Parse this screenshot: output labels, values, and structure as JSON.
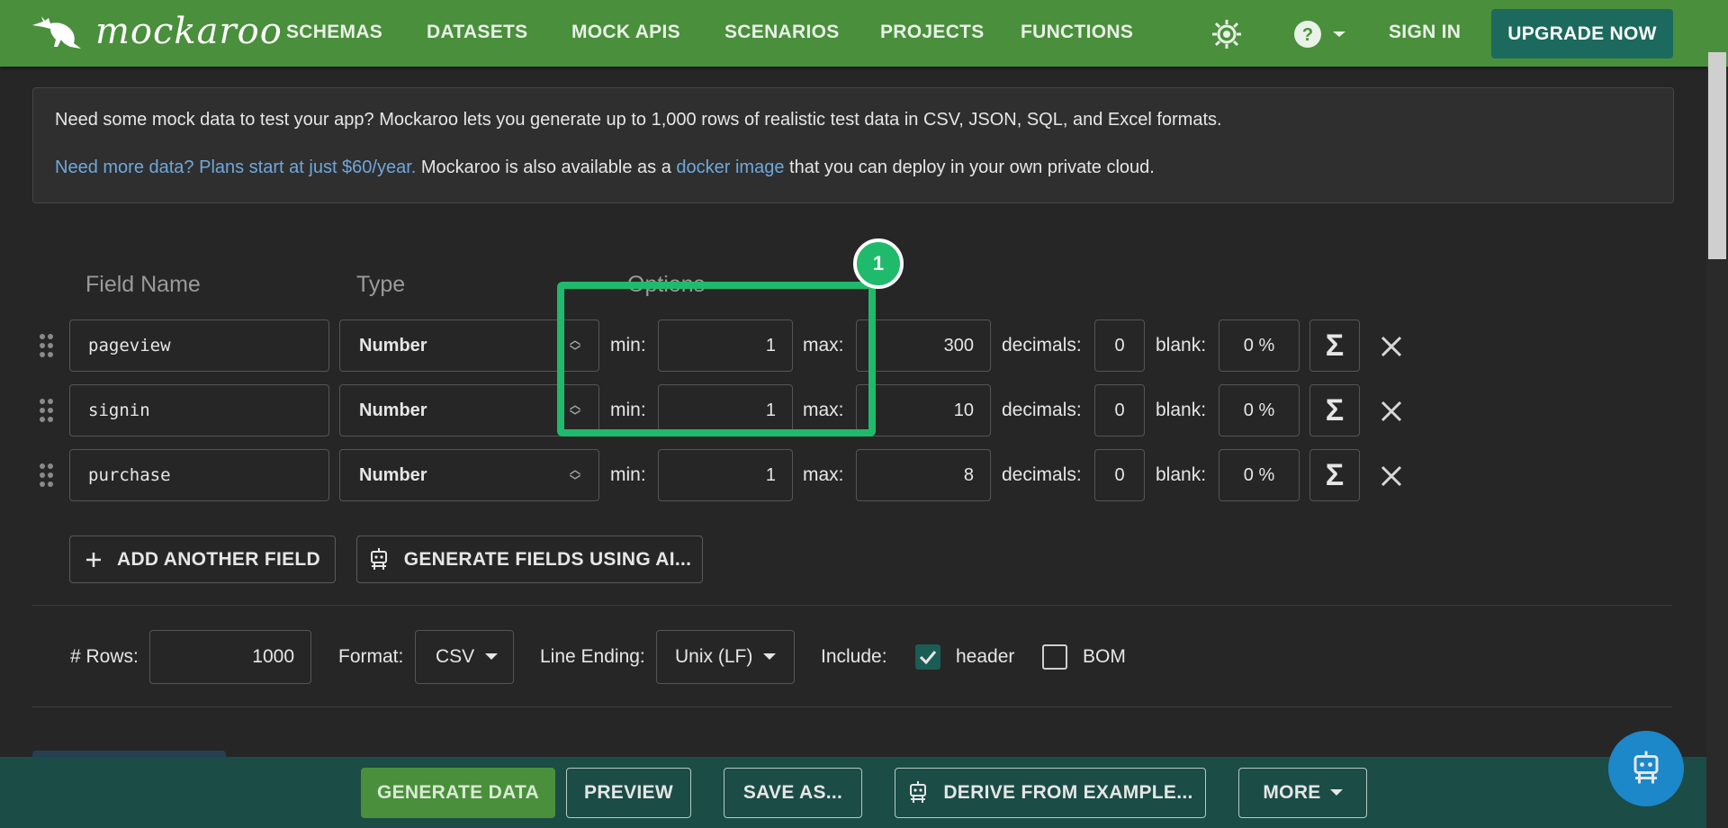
{
  "nav": {
    "brand": "mockaroo",
    "links": [
      "SCHEMAS",
      "DATASETS",
      "MOCK APIS",
      "SCENARIOS",
      "PROJECTS",
      "FUNCTIONS"
    ],
    "sign_in": "SIGN IN",
    "upgrade": "UPGRADE NOW"
  },
  "info": {
    "line1": "Need some mock data to test your app? Mockaroo lets you generate up to 1,000 rows of realistic test data in CSV, JSON, SQL, and Excel formats.",
    "line2_link": "Need more data? Plans start at just $60/year.",
    "line2_mid": " Mockaroo is also available as a ",
    "line2_link2": "docker image",
    "line2_end": " that you can deploy in your own private cloud."
  },
  "columns": {
    "field_name": "Field Name",
    "type": "Type",
    "options": "Options"
  },
  "labels": {
    "min": "min:",
    "max": "max:",
    "decimals": "decimals:",
    "blank": "blank:"
  },
  "fields": [
    {
      "name": "pageview",
      "type": "Number",
      "min": "1",
      "max": "300",
      "decimals": "0",
      "blank": "0 %"
    },
    {
      "name": "signin",
      "type": "Number",
      "min": "1",
      "max": "10",
      "decimals": "0",
      "blank": "0 %"
    },
    {
      "name": "purchase",
      "type": "Number",
      "min": "1",
      "max": "8",
      "decimals": "0",
      "blank": "0 %"
    }
  ],
  "highlight_badge": "1",
  "actions": {
    "add_field": "ADD ANOTHER FIELD",
    "generate_ai": "GENERATE FIELDS USING AI..."
  },
  "settings": {
    "rows_label": "# Rows:",
    "rows_value": "1000",
    "format_label": "Format:",
    "format_value": "CSV",
    "line_ending_label": "Line Ending:",
    "line_ending_value": "Unix (LF)",
    "include_label": "Include:",
    "header_label": "header",
    "header_checked": true,
    "bom_label": "BOM",
    "bom_checked": false
  },
  "footer": {
    "generate": "GENERATE DATA",
    "preview": "PREVIEW",
    "save_as": "SAVE AS...",
    "derive": "DERIVE FROM EXAMPLE...",
    "more": "MORE"
  },
  "colors": {
    "nav_bg": "#4a8f3c",
    "upgrade_bg": "#1b6a5d",
    "footer_bg": "#1b4c46",
    "accent_green": "#1fba6b",
    "link": "#6fa8dc"
  }
}
